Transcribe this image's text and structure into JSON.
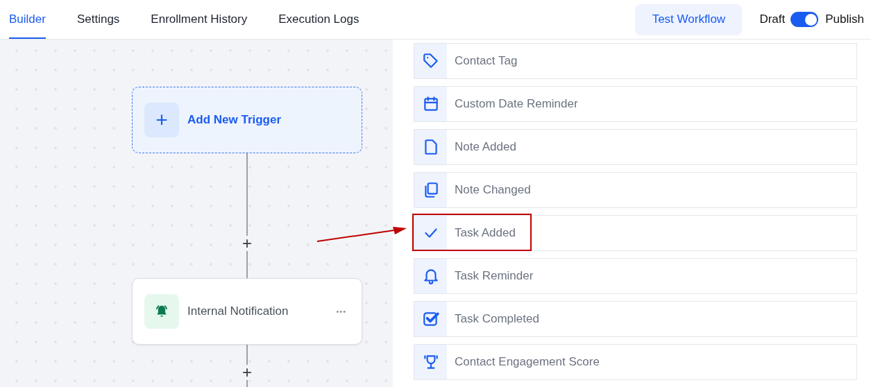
{
  "tabs": [
    {
      "label": "Builder",
      "selected": true
    },
    {
      "label": "Settings",
      "selected": false
    },
    {
      "label": "Enrollment History",
      "selected": false
    },
    {
      "label": "Execution Logs",
      "selected": false
    }
  ],
  "header_actions": {
    "test_button": "Test Workflow",
    "publish_toggle": {
      "off_label": "Draft",
      "on_label": "Publish",
      "on": true
    }
  },
  "canvas": {
    "trigger": {
      "label": "Add New Trigger",
      "add_symbol": "+"
    },
    "connectors": [
      {
        "add_symbol": "+"
      },
      {
        "add_symbol": "+"
      }
    ],
    "action": {
      "label": "Internal Notification",
      "menu": "•••"
    }
  },
  "trigger_list": [
    {
      "label": "Contact Tag",
      "highlighted": false
    },
    {
      "label": "Custom Date Reminder",
      "highlighted": false
    },
    {
      "label": "Note Added",
      "highlighted": false
    },
    {
      "label": "Note Changed",
      "highlighted": false
    },
    {
      "label": "Task Added",
      "highlighted": true
    },
    {
      "label": "Task Reminder",
      "highlighted": false
    },
    {
      "label": "Task Completed",
      "highlighted": false
    },
    {
      "label": "Contact Engagement Score",
      "highlighted": false
    }
  ]
}
